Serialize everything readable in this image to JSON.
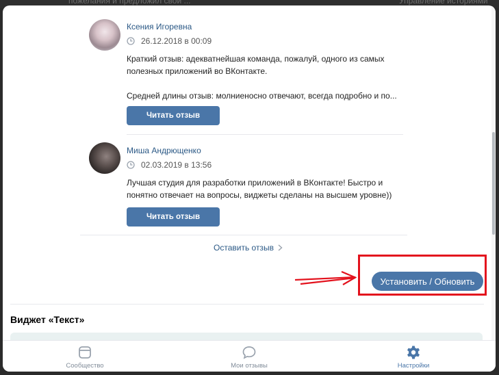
{
  "background": {
    "top_left_text": "пожелания и предложил свой ...",
    "top_right_text": "Управление историями"
  },
  "reviews": [
    {
      "author": "Ксения Игоревна",
      "date": "26.12.2018 в 00:09",
      "text": "Краткий отзыв: адекватнейшая команда, пожалуй, одного из самых полезных приложений во ВКонтакте.\n\nСредней длины отзыв: молниеносно отвечают, всегда подробно и по...",
      "button_label": "Читать отзыв"
    },
    {
      "author": "Миша Андрющенко",
      "date": "02.03.2019 в 13:56",
      "text": "Лучшая студия для разработки приложений в ВКонтакте! Быстро и понятно отвечает на вопросы, виджеты сделаны на высшем уровне))",
      "button_label": "Читать отзыв"
    }
  ],
  "leave_review_label": "Оставить отзыв",
  "install_button_label": "Установить / Обновить",
  "widget_section_title": "Виджет «Текст»",
  "tabs": [
    {
      "label": "Сообщество",
      "icon": "community-icon",
      "active": false
    },
    {
      "label": "Мои отзывы",
      "icon": "chat-bubble-icon",
      "active": false
    },
    {
      "label": "Настройки",
      "icon": "gear-icon",
      "active": true
    }
  ],
  "colors": {
    "accent": "#4a76a8",
    "link": "#2a5885",
    "highlight_red": "#e3121d",
    "inactive_tab": "#818c99"
  }
}
